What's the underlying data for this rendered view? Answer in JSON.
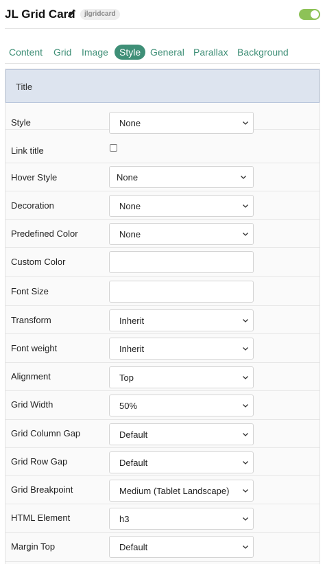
{
  "header": {
    "title": "JL Grid Card",
    "badge": "jlgridcard",
    "enabled": true
  },
  "tabs": [
    {
      "label": "Content",
      "active": false
    },
    {
      "label": "Grid",
      "active": false
    },
    {
      "label": "Image",
      "active": false
    },
    {
      "label": "Style",
      "active": true
    },
    {
      "label": "General",
      "active": false
    },
    {
      "label": "Parallax",
      "active": false
    },
    {
      "label": "Background",
      "active": false
    }
  ],
  "section": {
    "title": "Title"
  },
  "fields": [
    {
      "label": "Style",
      "type": "select",
      "value": "None"
    },
    {
      "label": "Link title",
      "type": "checkbox",
      "checked": false
    },
    {
      "label": "Hover Style",
      "type": "select",
      "value": "None"
    },
    {
      "label": "Decoration",
      "type": "select",
      "value": "None"
    },
    {
      "label": "Predefined Color",
      "type": "select",
      "value": "None"
    },
    {
      "label": "Custom Color",
      "type": "text",
      "value": ""
    },
    {
      "label": "Font Size",
      "type": "text",
      "value": ""
    },
    {
      "label": "Transform",
      "type": "select",
      "value": "Inherit"
    },
    {
      "label": "Font weight",
      "type": "select",
      "value": "Inherit"
    },
    {
      "label": "Alignment",
      "type": "select",
      "value": "Top"
    },
    {
      "label": "Grid Width",
      "type": "select",
      "value": "50%"
    },
    {
      "label": "Grid Column Gap",
      "type": "select",
      "value": "Default"
    },
    {
      "label": "Grid Row Gap",
      "type": "select",
      "value": "Default"
    },
    {
      "label": "Grid Breakpoint",
      "type": "select",
      "value": "Medium (Tablet Landscape)"
    },
    {
      "label": "HTML Element",
      "type": "select",
      "value": "h3"
    },
    {
      "label": "Margin Top",
      "type": "select",
      "value": "Default"
    }
  ],
  "colors": {
    "accent": "#3f8f77",
    "toggle": "#8dc257",
    "section_bg": "#dde4ef"
  }
}
